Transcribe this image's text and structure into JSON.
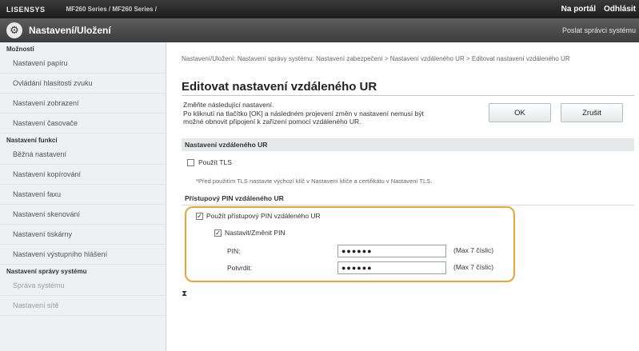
{
  "topbar": {
    "brand": "LISENSYS",
    "model": "MF260 Series / MF260 Series /",
    "portal_link": "Na portál",
    "logout_link": "Odhlásit"
  },
  "header": {
    "title": "Nastavení/Uložení",
    "admin_link": "Poslat správci systému"
  },
  "sidebar": {
    "section_options": "Možnosti",
    "options_items": [
      "Nastavení papíru",
      "Ovládání hlasitosti zvuku",
      "Nastavení zobrazení",
      "Nastavení časovače"
    ],
    "section_functions": "Nastavení funkcí",
    "function_items": [
      "Běžná nastavení",
      "Nastavení kopírování",
      "Nastavení faxu",
      "Nastavení skenování",
      "Nastavení tiskárny",
      "Nastavení výstupního hlášení"
    ],
    "section_admin": "Nastavení správy systému",
    "admin_items": [
      "Správa systému",
      "Nastavení sítě"
    ]
  },
  "main": {
    "breadcrumb": "Nastavení/Uložení: Nastavení správy systému: Nastavení zabezpečení > Nastavení vzdáleného UR > Editovat nastavení vzdáleného UR",
    "title": "Editovat nastavení vzdáleného UR",
    "intro_lines": [
      "Změňte následující nastavení.",
      "Po kliknutí na tlačítko [OK] a následném projevení změn v nastavení nemusí být",
      "možné obnovit připojení k zařízení pomocí vzdáleného UR."
    ],
    "ok_label": "OK",
    "cancel_label": "Zrušit",
    "section_title": "Nastavení vzdáleného UR",
    "use_tls_label": "Použít TLS",
    "use_tls_checked": false,
    "tls_note": "*Před použitím TLS nastavte výchozí klíč v Nastavení klíče a certifikátu v Nastavení TLS.",
    "pin_section_title": "Přístupový PIN vzdáleného UR",
    "use_pin_label": "Použít přístupový PIN vzdáleného UR",
    "use_pin_checked": true,
    "set_pin_label": "Nastavit/Změnit PIN",
    "set_pin_checked": true,
    "pin_label": "PIN:",
    "pin_value": "●●●●●●",
    "pin_hint": "(Max 7 číslic)",
    "confirm_label": "Potvrdit:",
    "confirm_value": "●●●●●●",
    "confirm_hint": "(Max 7 číslic)",
    "pager": "⧗"
  },
  "colors": {
    "highlight": "#f0a23a",
    "topbar": "#1c1c1c",
    "sidebar_bg": "#eef0f2"
  },
  "icons": {
    "header_icon": "settings-gear-icon",
    "check_glyph": "✓"
  }
}
